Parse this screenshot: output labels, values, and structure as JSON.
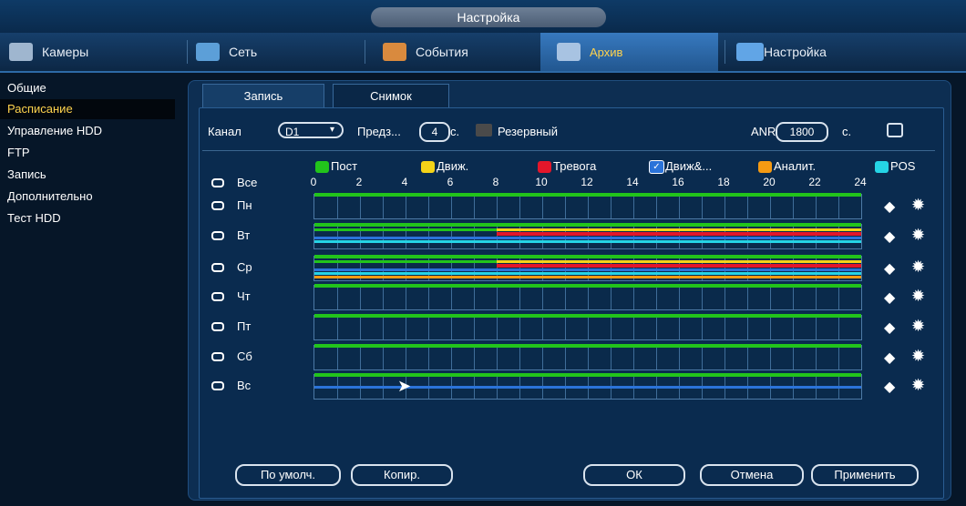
{
  "window": {
    "title": "Настройка"
  },
  "tabs": [
    {
      "label": "Камеры",
      "icon": "camera-icon"
    },
    {
      "label": "Сеть",
      "icon": "network-icon"
    },
    {
      "label": "События",
      "icon": "events-icon"
    },
    {
      "label": "Архив",
      "icon": "archive-icon"
    },
    {
      "label": "Настройка",
      "icon": "settings-icon"
    }
  ],
  "active_tab": "Архив",
  "sidebar": {
    "items": [
      {
        "label": "Общие"
      },
      {
        "label": "Расписание"
      },
      {
        "label": "Управление HDD"
      },
      {
        "label": "FTP"
      },
      {
        "label": "Запись"
      },
      {
        "label": "Дополнительно"
      },
      {
        "label": "Тест HDD"
      }
    ],
    "active": "Расписание"
  },
  "subtabs": [
    {
      "label": "Запись"
    },
    {
      "label": "Снимок"
    }
  ],
  "form": {
    "channel_label": "Канал",
    "channel_value": "D1",
    "prerecord_label": "Предз...",
    "prerecord_value": "4",
    "prerecord_unit": "с.",
    "redundancy_label": "Резервный",
    "anr_label": "ANR",
    "anr_value": "1800",
    "anr_unit": "с."
  },
  "legend": [
    {
      "label": "Пост",
      "color": "#22c41b"
    },
    {
      "label": "Движ.",
      "color": "#f4d318"
    },
    {
      "label": "Тревога",
      "color": "#e3162a"
    },
    {
      "label": "Движ&...",
      "color": "#2b73d9"
    },
    {
      "label": "Аналит.",
      "color": "#f59a12"
    },
    {
      "label": "POS",
      "color": "#25d4e6"
    }
  ],
  "all_label": "Все",
  "hours": [
    "0",
    "2",
    "4",
    "6",
    "8",
    "10",
    "12",
    "14",
    "16",
    "18",
    "20",
    "22",
    "24"
  ],
  "days": [
    {
      "label": "Пн",
      "linked": false
    },
    {
      "label": "Вт",
      "linked": true
    },
    {
      "label": "Ср",
      "linked": true
    },
    {
      "label": "Чт",
      "linked": false
    },
    {
      "label": "Пт",
      "linked": false
    },
    {
      "label": "Сб",
      "linked": false
    },
    {
      "label": "Вс",
      "linked": false
    }
  ],
  "buttons": {
    "default": "По умолч.",
    "copy": "Копир.",
    "ok": "ОК",
    "cancel": "Отмена",
    "apply": "Применить"
  }
}
